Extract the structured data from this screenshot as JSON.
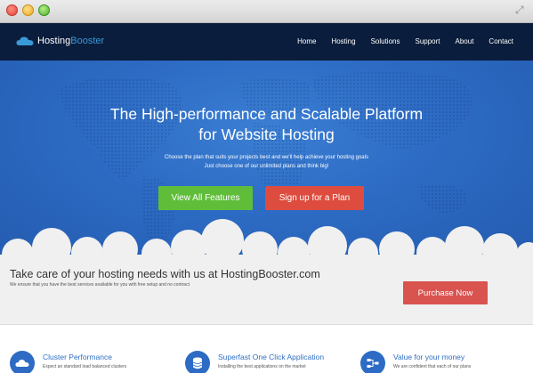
{
  "window": {
    "controls": [
      "close-button",
      "minimize-button",
      "zoom-button"
    ],
    "expand_icon": "expand-arrows-icon"
  },
  "nav": {
    "logo": {
      "part1": "Hosting",
      "part2": "Booster",
      "icon": "cloud-icon"
    },
    "links": [
      "Home",
      "Hosting",
      "Solutions",
      "Support",
      "About",
      "Contact"
    ]
  },
  "hero": {
    "title_line1": "The High-performance and Scalable Platform",
    "title_line2": "for Website Hosting",
    "subtitle_line1": "Choose the plan that suits your projects best and we'll help achieve your hosting goals",
    "subtitle_line2": "Just choose one of our unlimited plans and think big!",
    "primary_button": "View All Features",
    "secondary_button": "Sign up for a Plan",
    "colors": {
      "background": "#2d6bc4",
      "primary": "#5fbd3a",
      "secondary": "#dd4c3e"
    }
  },
  "cta": {
    "title": "Take care of your hosting needs with us at HostingBooster.com",
    "subtitle": "We ensure that you have the best services available for you with free setup and no contract",
    "button": "Purchase Now",
    "button_color": "#d9534f"
  },
  "features": [
    {
      "title": "Cluster Performance",
      "description": "Expect an standard load balanced clusters",
      "icon": "cloud-icon"
    },
    {
      "title": "Superfast One Click Application",
      "description": "Installing the best applications on the market",
      "icon": "database-icon"
    },
    {
      "title": "Value for your money",
      "description": "We are confident that each of our plans",
      "icon": "network-icon"
    }
  ]
}
